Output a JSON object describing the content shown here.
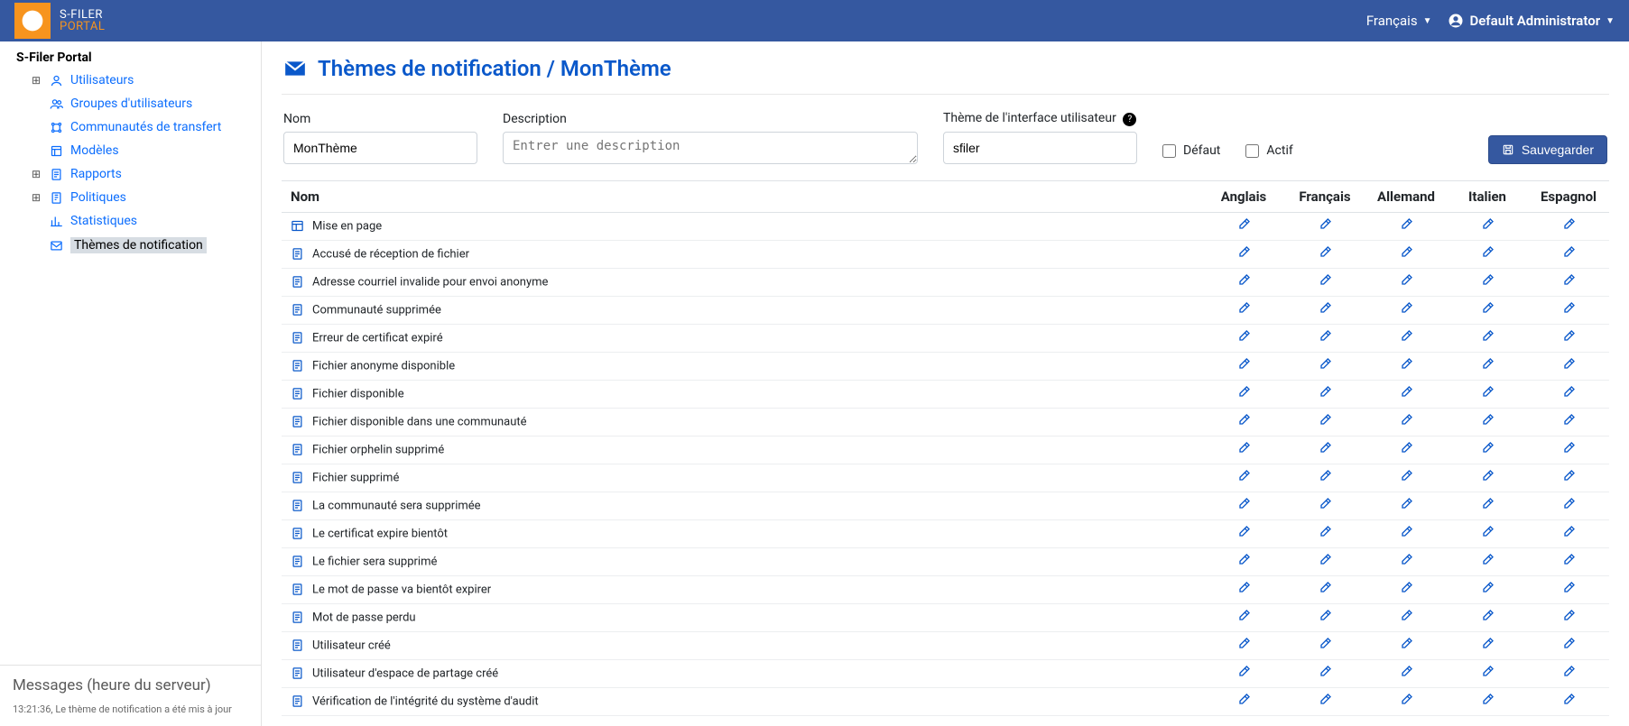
{
  "app": {
    "name1": "S-FILER",
    "name2": "PORTAL"
  },
  "header": {
    "language_label": "Français",
    "user_label": "Default Administrator"
  },
  "sidebar": {
    "root_label": "S-Filer Portal",
    "items": [
      {
        "label": "Utilisateurs",
        "expandable": true,
        "icon": "user"
      },
      {
        "label": "Groupes d'utilisateurs",
        "expandable": false,
        "icon": "users"
      },
      {
        "label": "Communautés de transfert",
        "expandable": false,
        "icon": "network"
      },
      {
        "label": "Modèles",
        "expandable": false,
        "icon": "template"
      },
      {
        "label": "Rapports",
        "expandable": true,
        "icon": "report"
      },
      {
        "label": "Politiques",
        "expandable": true,
        "icon": "policy"
      },
      {
        "label": "Statistiques",
        "expandable": false,
        "icon": "stats"
      },
      {
        "label": "Thèmes de notification",
        "expandable": false,
        "icon": "mail",
        "selected": true
      }
    ]
  },
  "messages": {
    "title": "Messages (heure du serveur)",
    "log": "13:21:36, Le thème de notification a été mis à jour"
  },
  "page": {
    "title": "Thèmes de notification / MonThème",
    "form": {
      "name_label": "Nom",
      "name_value": "MonThème",
      "description_label": "Description",
      "description_placeholder": "Entrer une description",
      "description_value": "",
      "ui_theme_label": "Thème de l'interface utilisateur",
      "ui_theme_value": "sfiler",
      "default_label": "Défaut",
      "default_checked": false,
      "active_label": "Actif",
      "active_checked": false,
      "save_label": "Sauvegarder"
    },
    "table": {
      "columns": {
        "name": "Nom",
        "english": "Anglais",
        "french": "Français",
        "german": "Allemand",
        "italian": "Italien",
        "spanish": "Espagnol"
      },
      "rows": [
        {
          "name": "Mise en page",
          "icon": "layout"
        },
        {
          "name": "Accusé de réception de fichier",
          "icon": "doc"
        },
        {
          "name": "Adresse courriel invalide pour envoi anonyme",
          "icon": "doc"
        },
        {
          "name": "Communauté supprimée",
          "icon": "doc"
        },
        {
          "name": "Erreur de certificat expiré",
          "icon": "doc"
        },
        {
          "name": "Fichier anonyme disponible",
          "icon": "doc"
        },
        {
          "name": "Fichier disponible",
          "icon": "doc"
        },
        {
          "name": "Fichier disponible dans une communauté",
          "icon": "doc"
        },
        {
          "name": "Fichier orphelin supprimé",
          "icon": "doc"
        },
        {
          "name": "Fichier supprimé",
          "icon": "doc"
        },
        {
          "name": "La communauté sera supprimée",
          "icon": "doc"
        },
        {
          "name": "Le certificat expire bientôt",
          "icon": "doc"
        },
        {
          "name": "Le fichier sera supprimé",
          "icon": "doc"
        },
        {
          "name": "Le mot de passe va bientôt expirer",
          "icon": "doc"
        },
        {
          "name": "Mot de passe perdu",
          "icon": "doc"
        },
        {
          "name": "Utilisateur créé",
          "icon": "doc"
        },
        {
          "name": "Utilisateur d'espace de partage créé",
          "icon": "doc"
        },
        {
          "name": "Vérification de l'intégrité du système d'audit",
          "icon": "doc"
        }
      ]
    }
  }
}
